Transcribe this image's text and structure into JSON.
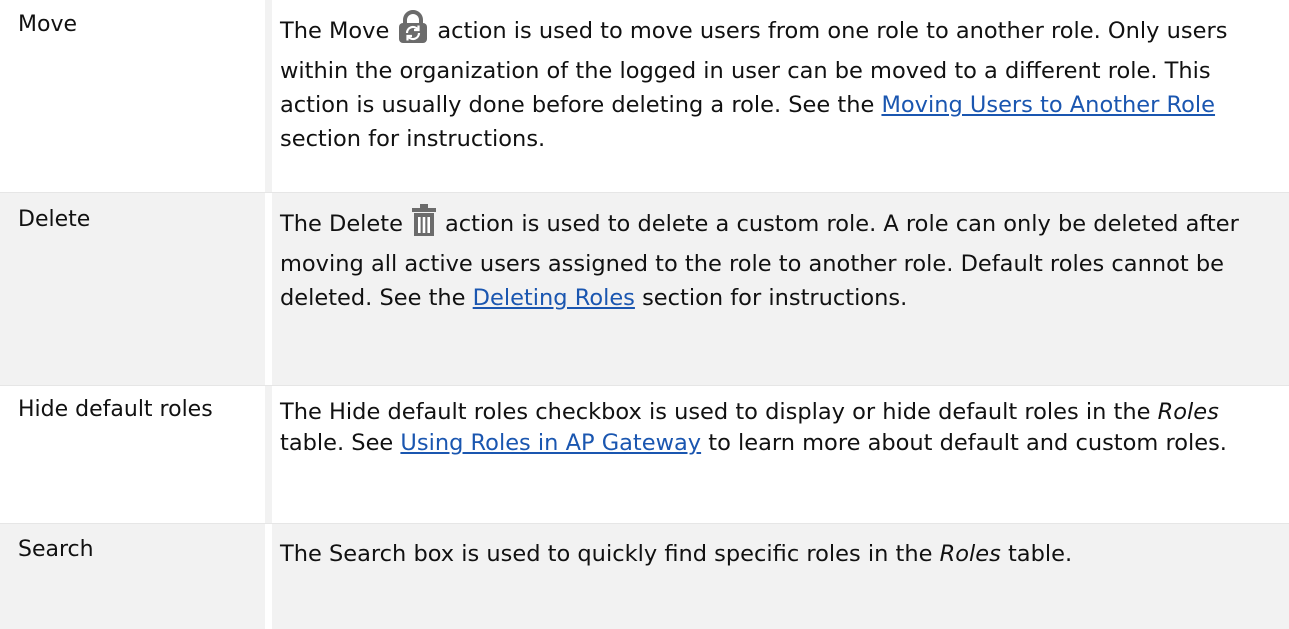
{
  "rows": [
    {
      "name": "Move",
      "desc": {
        "pre": "The Move",
        "icon": "lock-refresh-icon",
        "mid": "action is used to move users from one role to another role. Only users within the organization of the logged in user can be moved to a different role. This action is usually done before deleting a role. See the",
        "link": "Moving Users to Another Role",
        "post": "section for instructions."
      }
    },
    {
      "name": "Delete",
      "desc": {
        "pre": "The Delete",
        "icon": "trash-icon",
        "mid": "action is used to delete a custom role. A role can only be deleted after moving all active users assigned to the role to another role. Default roles cannot be deleted. See the",
        "link": "Deleting Roles",
        "post": "section for instructions."
      }
    },
    {
      "name": "Hide default roles",
      "desc": {
        "pre": "The Hide default roles checkbox is used to display or hide default roles in the",
        "italic": "Roles",
        "mid": "table. See",
        "link": "Using Roles in AP Gateway",
        "post": "to learn more about default and custom roles."
      }
    },
    {
      "name": "Search",
      "desc": {
        "pre": "The Search box is used to quickly find specific roles in the",
        "italic": "Roles",
        "post": "table."
      }
    }
  ],
  "colors": {
    "link": "#1a56b0",
    "icon_gray": "#6b6b6b",
    "row_shade": "#f2f2f2"
  }
}
